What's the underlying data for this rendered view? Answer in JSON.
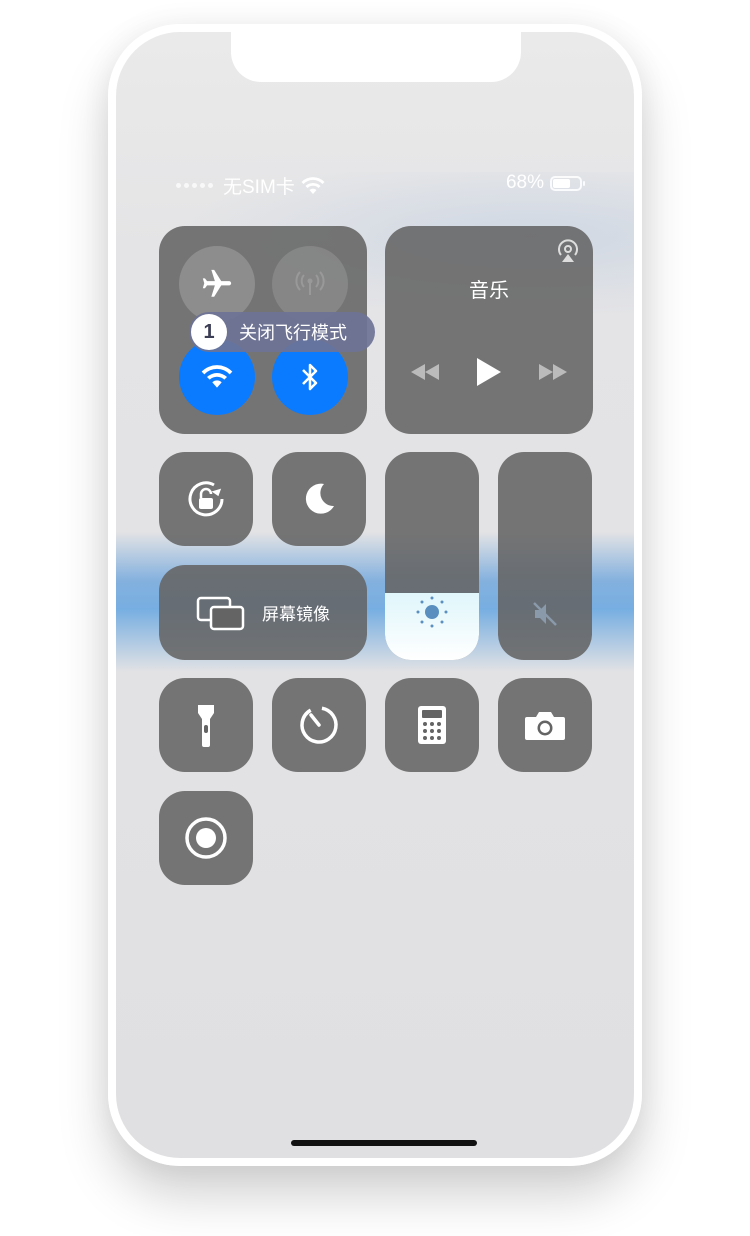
{
  "status_bar": {
    "carrier": "无SIM卡",
    "battery_percent": "68%",
    "battery_level": 0.68
  },
  "connectivity": {
    "airplane_mode": true,
    "cellular_data": false,
    "wifi": true,
    "bluetooth": true
  },
  "tooltip": {
    "step_number": "1",
    "text": "关闭飞行模式"
  },
  "music": {
    "title": "音乐"
  },
  "screen_mirroring": {
    "label": "屏幕镜像"
  },
  "sliders": {
    "brightness_level": 0.32,
    "volume_level": 0,
    "volume_muted": true
  },
  "colors": {
    "accent_blue": "#0a7bff",
    "tile_gray": "#646464",
    "tooltip_bg": "#6e7396"
  },
  "icons": {
    "airplane": "airplane-icon",
    "cellular": "cellular-antenna-icon",
    "wifi": "wifi-icon",
    "bluetooth": "bluetooth-icon",
    "airplay": "airplay-icon",
    "rewind": "rewind-icon",
    "play": "play-icon",
    "fast_forward": "fast-forward-icon",
    "rotation_lock": "rotation-lock-icon",
    "do_not_disturb": "moon-icon",
    "screen_mirroring": "screen-mirroring-icon",
    "brightness": "sun-icon",
    "mute": "speaker-muted-icon",
    "flashlight": "flashlight-icon",
    "timer": "timer-icon",
    "calculator": "calculator-icon",
    "camera": "camera-icon",
    "screen_record": "screen-record-icon"
  }
}
